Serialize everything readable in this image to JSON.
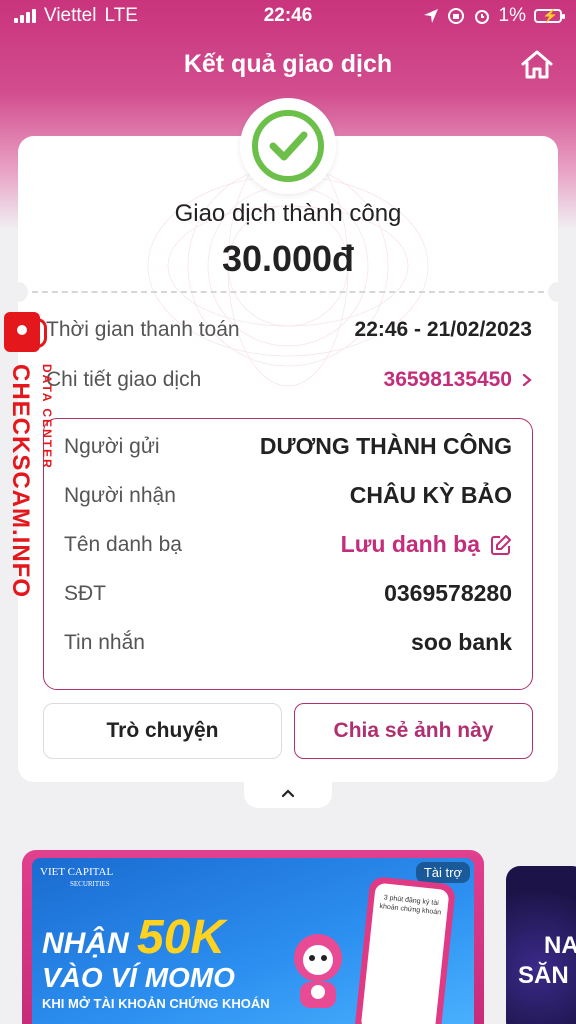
{
  "status_bar": {
    "carrier": "Viettel",
    "network": "LTE",
    "time": "22:46",
    "battery": "1%"
  },
  "header": {
    "title": "Kết quả giao dịch"
  },
  "result": {
    "status": "Giao dịch thành công",
    "amount": "30.000đ"
  },
  "summary": {
    "time_label": "Thời gian thanh toán",
    "time_value": "22:46 - 21/02/2023",
    "detail_label": "Chi tiết giao dịch",
    "detail_value": "36598135450"
  },
  "details": {
    "sender_label": "Người gửi",
    "sender_value": "DƯƠNG THÀNH CÔNG",
    "receiver_label": "Người nhận",
    "receiver_value": "CHÂU KỲ BẢO",
    "contact_label": "Tên danh bạ",
    "contact_value": "Lưu danh bạ",
    "phone_label": "SĐT",
    "phone_value": "0369578280",
    "message_label": "Tin nhắn",
    "message_value": "soo bank"
  },
  "actions": {
    "chat": "Trò chuyện",
    "share": "Chia sẻ ảnh này"
  },
  "watermark": {
    "main": "CHECKSCAM.INFO",
    "sub": "DATA CENTER"
  },
  "banner": {
    "brand": "VIET CAPITAL",
    "brand_sub": "SECURITIES",
    "sponsor": "Tài trợ",
    "line1_prefix": "NHẬN",
    "line1_big": "50K",
    "line2": "VÀO VÍ MOMO",
    "line3": "KHI MỞ TÀI KHOẢN CHỨNG KHOÁN",
    "phone_text": "3 phút đăng ký tài khoản chứng khoán"
  },
  "banner2": {
    "line1": "NA",
    "line2": "SĂN"
  },
  "colors": {
    "brand_pink": "#c32d7a",
    "success_green": "#6cc04a",
    "watermark_red": "#e3171c"
  }
}
